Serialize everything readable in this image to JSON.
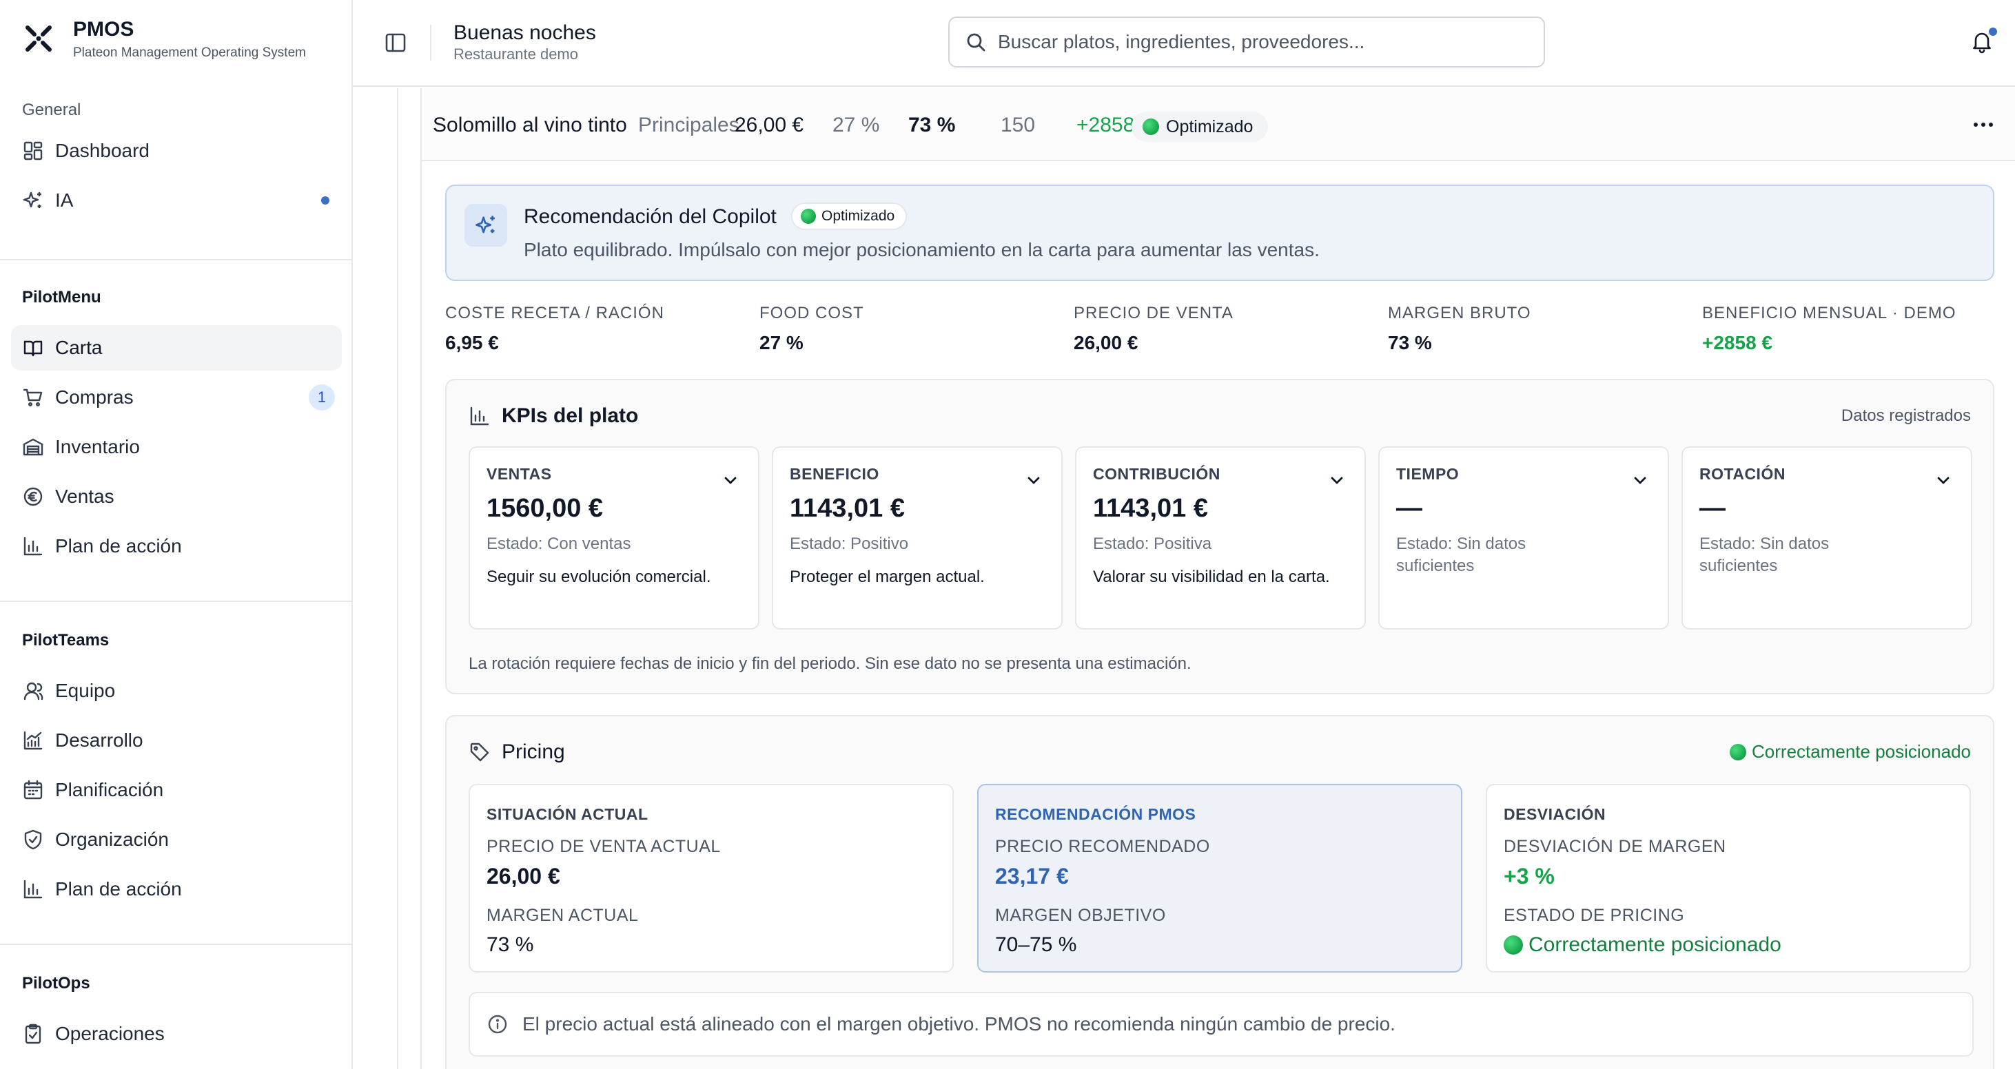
{
  "brand": {
    "name": "PMOS",
    "subtitle": "Plateon Management Operating System"
  },
  "sidebar": {
    "sections": [
      {
        "title": "General",
        "items": [
          {
            "label": "Dashboard",
            "icon": "dashboard-icon"
          },
          {
            "label": "IA",
            "icon": "sparkles-icon",
            "dot": true
          }
        ]
      },
      {
        "title": "PilotMenu",
        "items": [
          {
            "label": "Carta",
            "icon": "book-icon",
            "active": true
          },
          {
            "label": "Compras",
            "icon": "cart-icon",
            "count": "1"
          },
          {
            "label": "Inventario",
            "icon": "warehouse-icon"
          },
          {
            "label": "Ventas",
            "icon": "euro-icon"
          },
          {
            "label": "Plan de acción",
            "icon": "bar-chart-icon"
          }
        ]
      },
      {
        "title": "PilotTeams",
        "items": [
          {
            "label": "Equipo",
            "icon": "user-icon"
          },
          {
            "label": "Desarrollo",
            "icon": "growth-chart-icon"
          },
          {
            "label": "Planificación",
            "icon": "calendar-icon"
          },
          {
            "label": "Organización",
            "icon": "shield-icon"
          },
          {
            "label": "Plan de acción",
            "icon": "bar-chart-icon"
          }
        ]
      },
      {
        "title": "PilotOps",
        "items": [
          {
            "label": "Operaciones",
            "icon": "clipboard-icon"
          }
        ]
      }
    ]
  },
  "header": {
    "greeting": "Buenas noches",
    "restaurant": "Restaurante demo",
    "search_placeholder": "Buscar platos, ingredientes, proveedores..."
  },
  "dish_row": {
    "name": "Solomillo al vino tinto",
    "category": "Principales",
    "price": "26,00 €",
    "food_cost": "27 %",
    "margin": "73 %",
    "units": "150",
    "benefit": "+2858 €",
    "status": "Optimizado"
  },
  "copilot": {
    "title": "Recomendación del Copilot",
    "badge": "Optimizado",
    "text": "Plato equilibrado. Impúlsalo con mejor posicionamiento en la carta para aumentar las ventas."
  },
  "metrics": [
    {
      "label": "COSTE RECETA / RACIÓN",
      "value": "6,95 €"
    },
    {
      "label": "FOOD COST",
      "value": "27 %"
    },
    {
      "label": "PRECIO DE VENTA",
      "value": "26,00 €"
    },
    {
      "label": "MARGEN BRUTO",
      "value": "73 %"
    },
    {
      "label": "BENEFICIO MENSUAL · DEMO",
      "value": "+2858 €"
    }
  ],
  "kpis": {
    "title": "KPIs del plato",
    "right_label": "Datos registrados",
    "cards": [
      {
        "label": "VENTAS",
        "value": "1560,00 €",
        "state": "Estado: Con ventas",
        "note": "Seguir su evolución comercial."
      },
      {
        "label": "BENEFICIO",
        "value": "1143,01 €",
        "state": "Estado: Positivo",
        "note": "Proteger el margen actual."
      },
      {
        "label": "CONTRIBUCIÓN",
        "value": "1143,01 €",
        "state": "Estado: Positiva",
        "note": "Valorar su visibilidad en la carta."
      },
      {
        "label": "TIEMPO",
        "value": "—",
        "state": "Estado: Sin datos suficientes",
        "note": ""
      },
      {
        "label": "ROTACIÓN",
        "value": "—",
        "state": "Estado: Sin datos suficientes",
        "note": ""
      }
    ],
    "footnote": "La rotación requiere fechas de inicio y fin del periodo. Sin ese dato no se presenta una estimación."
  },
  "pricing": {
    "title": "Pricing",
    "status": "Correctamente posicionado",
    "cards": [
      {
        "head": "SITUACIÓN ACTUAL",
        "l1": "PRECIO DE VENTA ACTUAL",
        "v1": "26,00 €",
        "l2": "MARGEN ACTUAL",
        "v2": "73 %"
      },
      {
        "head": "RECOMENDACIÓN PMOS",
        "l1": "PRECIO RECOMENDADO",
        "v1": "23,17 €",
        "l2": "MARGEN OBJETIVO",
        "v2": "70–75 %"
      },
      {
        "head": "DESVIACIÓN",
        "l1": "DESVIACIÓN DE MARGEN",
        "v1": "+3 %",
        "l2": "ESTADO DE PRICING",
        "v2": "Correctamente posicionado"
      }
    ],
    "info": "El precio actual está alineado con el margen objetivo. PMOS no recomienda ningún cambio de precio."
  },
  "colors": {
    "accent_blue": "#2f64b3",
    "positive_green": "#16a34a",
    "border": "#e5e7eb"
  }
}
